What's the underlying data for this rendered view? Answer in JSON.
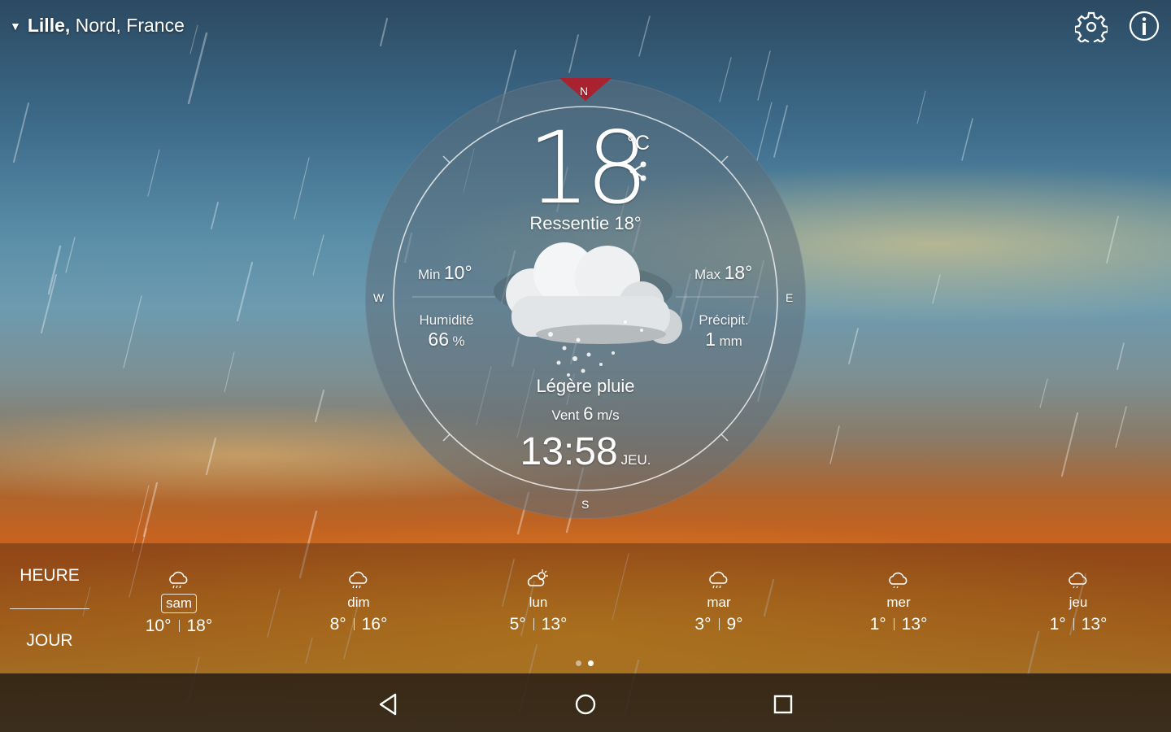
{
  "location": {
    "city": "Lille,",
    "region": " Nord, France"
  },
  "icons": {
    "settings": "gear-icon",
    "info": "info-icon",
    "share": "share-icon",
    "dropdown": "triangle-down-icon"
  },
  "current": {
    "temperature": "18",
    "unit": "°C",
    "feels_like": "Ressentie 18°",
    "min_label": "Min",
    "min_value": "10°",
    "max_label": "Max",
    "max_value": "18°",
    "humidity_label": "Humidité",
    "humidity_value": "66",
    "humidity_unit": "%",
    "precip_label": "Précipit.",
    "precip_value": "1",
    "precip_unit": "mm",
    "condition": "Légère pluie",
    "wind_label": "Vent",
    "wind_value": "6",
    "wind_unit": "m/s",
    "time": "13:58",
    "day": "JEU."
  },
  "compass": {
    "n": "N",
    "e": "E",
    "s": "S",
    "w": "W"
  },
  "modes": {
    "hour": "HEURE",
    "day": "JOUR"
  },
  "forecast": [
    {
      "day": "sam",
      "low": "10°",
      "high": "18°",
      "icon": "rain-cloud-icon",
      "selected": true
    },
    {
      "day": "dim",
      "low": "8°",
      "high": "16°",
      "icon": "rain-cloud-icon"
    },
    {
      "day": "lun",
      "low": "5°",
      "high": "13°",
      "icon": "partly-sunny-icon"
    },
    {
      "day": "mar",
      "low": "3°",
      "high": "9°",
      "icon": "rain-cloud-icon"
    },
    {
      "day": "mer",
      "low": "1°",
      "high": "13°",
      "icon": "cloud-icon"
    },
    {
      "day": "jeu",
      "low": "1°",
      "high": "13°",
      "icon": "cloud-icon"
    }
  ],
  "colors": {
    "compass_north": "#a8232f",
    "dial": "#5c6e7a"
  }
}
